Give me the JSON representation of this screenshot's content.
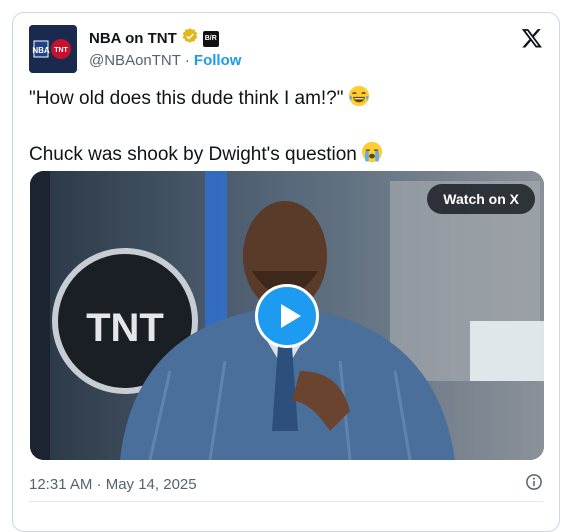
{
  "account": {
    "name": "NBA on TNT",
    "handle": "@NBAonTNT",
    "separator": "·",
    "follow_label": "Follow",
    "verified_badge": "verified-gold-icon",
    "affiliate_badge": "B/R",
    "avatar_text": "NBA TNT"
  },
  "tweet": {
    "line1": "\"How old does this dude think I am!?\"",
    "line1_emoji": "😂",
    "line2": "Chuck was shook by Dwight's question",
    "line2_emoji": "😭"
  },
  "media": {
    "watch_label": "Watch on X",
    "background_logo": "TNT",
    "play_icon": "play-icon"
  },
  "footer": {
    "timestamp": "12:31 AM · May 14, 2025",
    "info_icon": "info-icon"
  },
  "colors": {
    "accent": "#1d9bf0",
    "text": "#0f1419",
    "muted": "#536471",
    "verified_gold": "#e2b719"
  }
}
